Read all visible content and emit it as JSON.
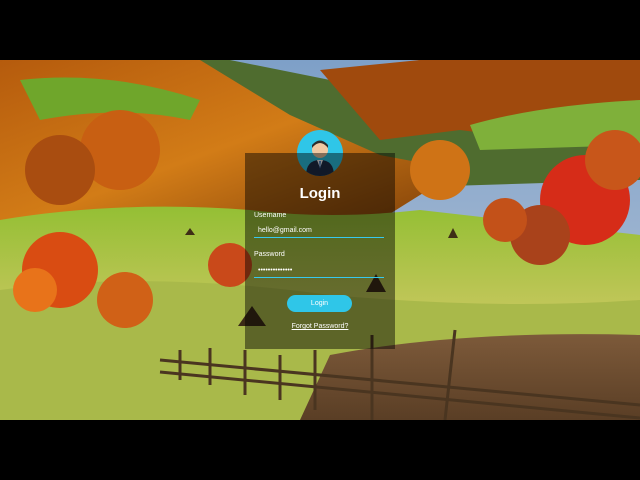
{
  "login": {
    "title": "Login",
    "username_label": "Username",
    "username_value": "hello@gmail.com",
    "password_label": "Password",
    "password_value": "••••••••••••••",
    "login_button": "Login",
    "forgot_link": "Forgot Password?"
  },
  "icons": {
    "avatar": "user-avatar-icon"
  },
  "colors": {
    "accent": "#2fc6e8",
    "card": "rgba(0,0,0,0.45)"
  }
}
